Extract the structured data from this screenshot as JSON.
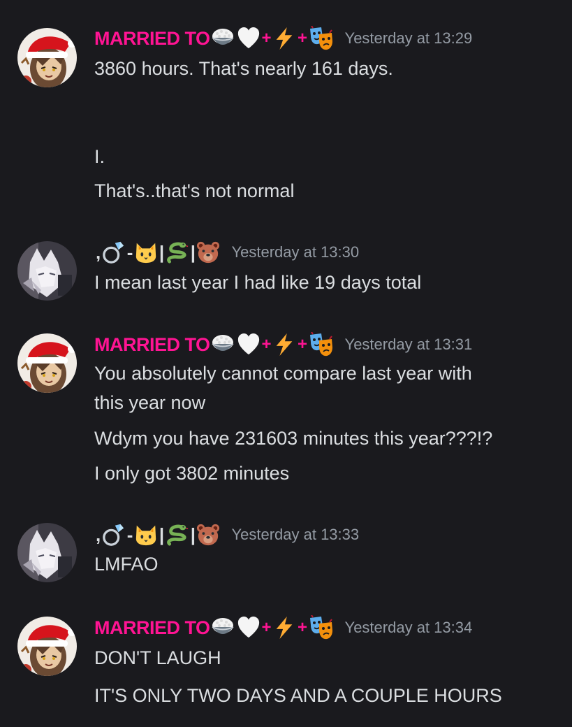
{
  "colors": {
    "background": "#1a1a1e",
    "text": "#dbdee1",
    "timestamp": "#949ba4",
    "username_pink": "#ff1493"
  },
  "users": {
    "married": {
      "name_text": "MARRIED TO",
      "plus": "+",
      "emoji_names": [
        "rice-bowl-emoji",
        "white-heart-emoji",
        "lightning-emoji",
        "performing-arts-emoji"
      ]
    },
    "ring": {
      "prefix": ",",
      "dash": "-",
      "bar": "|",
      "emoji_names": [
        "ring-emoji",
        "cat-emoji",
        "snake-emoji",
        "bear-emoji"
      ]
    }
  },
  "messages": [
    {
      "author": "married",
      "timestamp": "Yesterday at 13:29",
      "lines": [
        "3860 hours. That's nearly 161 days.",
        "I.",
        "That's..that's not normal"
      ]
    },
    {
      "author": "ring",
      "timestamp": "Yesterday at 13:30",
      "lines": [
        "I mean last year I had like 19 days total"
      ]
    },
    {
      "author": "married",
      "timestamp": "Yesterday at 13:31",
      "lines": [
        "You absolutely cannot compare last year with",
        "this year now",
        "Wdym you have 231603 minutes this year???!?",
        "I only got 3802 minutes"
      ]
    },
    {
      "author": "ring",
      "timestamp": "Yesterday at 13:33",
      "lines": [
        "LMFAO"
      ]
    },
    {
      "author": "married",
      "timestamp": "Yesterday at 13:34",
      "lines": [
        "DON'T LAUGH",
        "IT'S ONLY TWO DAYS AND A COUPLE HOURS"
      ]
    }
  ]
}
